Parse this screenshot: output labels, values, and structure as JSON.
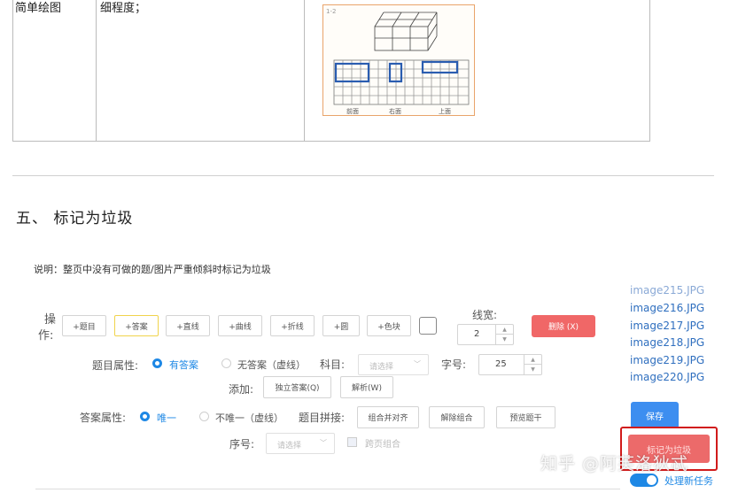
{
  "table": {
    "row": {
      "col1_text": "简单绘图",
      "col2_text": "细程度；",
      "figure": {
        "number": "1-2",
        "view_labels": [
          "前面",
          "右面",
          "上面"
        ]
      }
    }
  },
  "section": {
    "title": "五、 标记为垃圾",
    "note": "说明：整页中没有可做的题/图片严重倾斜时标记为垃圾"
  },
  "toolbar": {
    "op_label_1": "操",
    "op_label_2": "作:",
    "buttons": [
      "+题目",
      "+答案",
      "+直线",
      "+曲线",
      "+折线",
      "+圆",
      "+色块"
    ],
    "line_width_label": "线宽:",
    "line_width_value": "2",
    "delete_label": "删除 (X)"
  },
  "question_props": {
    "label": "题目属性:",
    "has_answer": "有答案",
    "no_answer": "无答案（虚线）",
    "subject_label": "科目:",
    "subject_placeholder": "请选择",
    "font_size_label": "字号:",
    "font_size_value": "25",
    "add_label": "添加:",
    "independent_answer": "独立答案(Q)",
    "analysis": "解析(W)"
  },
  "answer_props": {
    "label": "答案属性:",
    "unique": "唯一",
    "not_unique": "不唯一（虚线）",
    "join_label": "题目拼接:",
    "combine_align": "组合并对齐",
    "ungroup": "解除组合",
    "preview": "预览题干",
    "order_label": "序号:",
    "order_placeholder": "请选择",
    "cross_page": "跨页组合"
  },
  "image_list": [
    "image215.JPG",
    "image216.JPG",
    "image217.JPG",
    "image218.JPG",
    "image219.JPG",
    "image220.JPG"
  ],
  "actions": {
    "save": "保存",
    "mark_garbage": "标记为垃圾",
    "new_task_label": "处理新任务"
  },
  "watermark": "知乎 @阿芙洛狄忒",
  "colors": {
    "primary_blue": "#1e88e5",
    "delete_red": "#f06767",
    "highlight_red": "#d11b1b"
  }
}
